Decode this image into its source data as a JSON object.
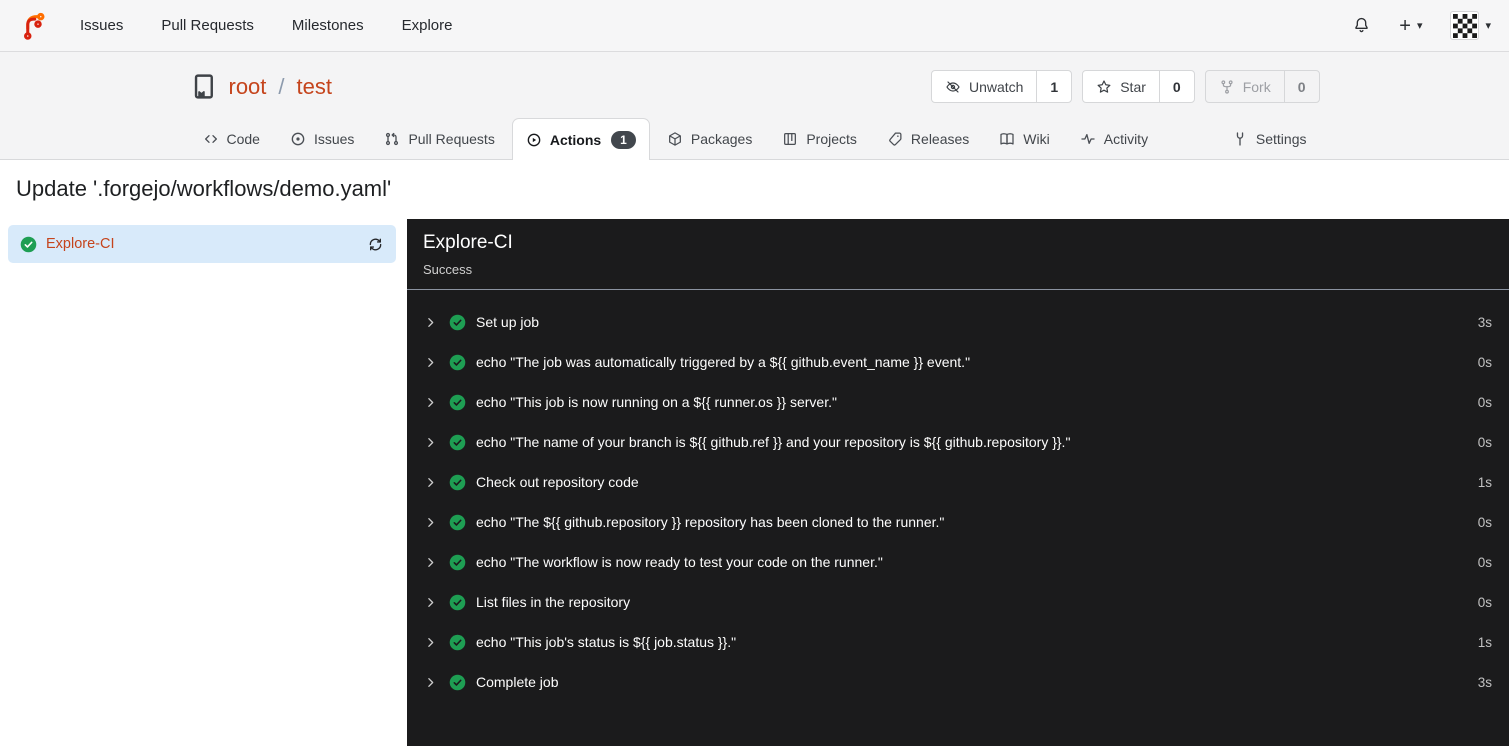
{
  "glyphs": {
    "plus": "+",
    "caret": "▾"
  },
  "topnav": {
    "items": [
      {
        "label": "Issues"
      },
      {
        "label": "Pull Requests"
      },
      {
        "label": "Milestones"
      },
      {
        "label": "Explore"
      }
    ]
  },
  "repo": {
    "owner": "root",
    "separator": "/",
    "name": "test",
    "watch": {
      "label": "Unwatch",
      "count": "1"
    },
    "star": {
      "label": "Star",
      "count": "0"
    },
    "fork": {
      "label": "Fork",
      "count": "0"
    }
  },
  "tabs": [
    {
      "label": "Code"
    },
    {
      "label": "Issues"
    },
    {
      "label": "Pull Requests"
    },
    {
      "label": "Actions",
      "badge": "1"
    },
    {
      "label": "Packages"
    },
    {
      "label": "Projects"
    },
    {
      "label": "Releases"
    },
    {
      "label": "Wiki"
    },
    {
      "label": "Activity"
    },
    {
      "label": "Settings"
    }
  ],
  "run": {
    "title": "Update '.forgejo/workflows/demo.yaml'",
    "job_name": "Explore-CI",
    "panel_title": "Explore-CI",
    "status": "Success",
    "steps": [
      {
        "name": "Set up job",
        "duration": "3s"
      },
      {
        "name": "echo \"The job was automatically triggered by a ${{ github.event_name }} event.\"",
        "duration": "0s"
      },
      {
        "name": "echo \"This job is now running on a ${{ runner.os }} server.\"",
        "duration": "0s"
      },
      {
        "name": "echo \"The name of your branch is ${{ github.ref }} and your repository is ${{ github.repository }}.\"",
        "duration": "0s"
      },
      {
        "name": "Check out repository code",
        "duration": "1s"
      },
      {
        "name": "echo \"The ${{ github.repository }} repository has been cloned to the runner.\"",
        "duration": "0s"
      },
      {
        "name": "echo \"The workflow is now ready to test your code on the runner.\"",
        "duration": "0s"
      },
      {
        "name": "List files in the repository",
        "duration": "0s"
      },
      {
        "name": "echo \"This job's status is ${{ job.status }}.\"",
        "duration": "1s"
      },
      {
        "name": "Complete job",
        "duration": "3s"
      }
    ]
  },
  "colors": {
    "accent_link": "#c5441c",
    "success_green": "#1e9e53",
    "selected_job_bg": "#d8eafa",
    "panel_bg": "#1b1b1c",
    "badge_bg": "#42474d"
  }
}
